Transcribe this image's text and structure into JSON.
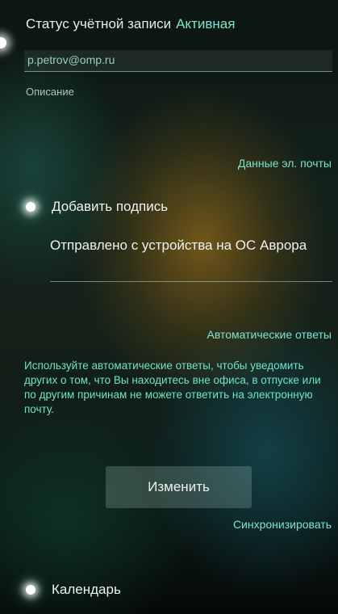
{
  "account": {
    "status_label": "Статус учётной записи",
    "status_value": "Активная",
    "email": "p.petrov@omp.ru",
    "description_label": "Описание"
  },
  "email_section": {
    "header": "Данные эл. почты",
    "signature_switch": {
      "label": "Добавить подпись",
      "checked": true
    },
    "signature_text": "Отправлено с устройства на ОС Аврора"
  },
  "auto_reply_section": {
    "header": "Автоматические ответы",
    "description": "Используйте автоматические ответы, чтобы уведомить других о том, что Вы находитесь вне офиса, в отпуске или по другим причинам не можете ответить на электронную почту.",
    "change_button": "Изменить"
  },
  "sync_section": {
    "header": "Синхронизировать",
    "calendar_switch": {
      "label": "Календарь",
      "checked": true
    }
  },
  "colors": {
    "accent": "#7fe3cf",
    "text_primary": "#eef2f0",
    "description_text": "#6fe3c9"
  }
}
